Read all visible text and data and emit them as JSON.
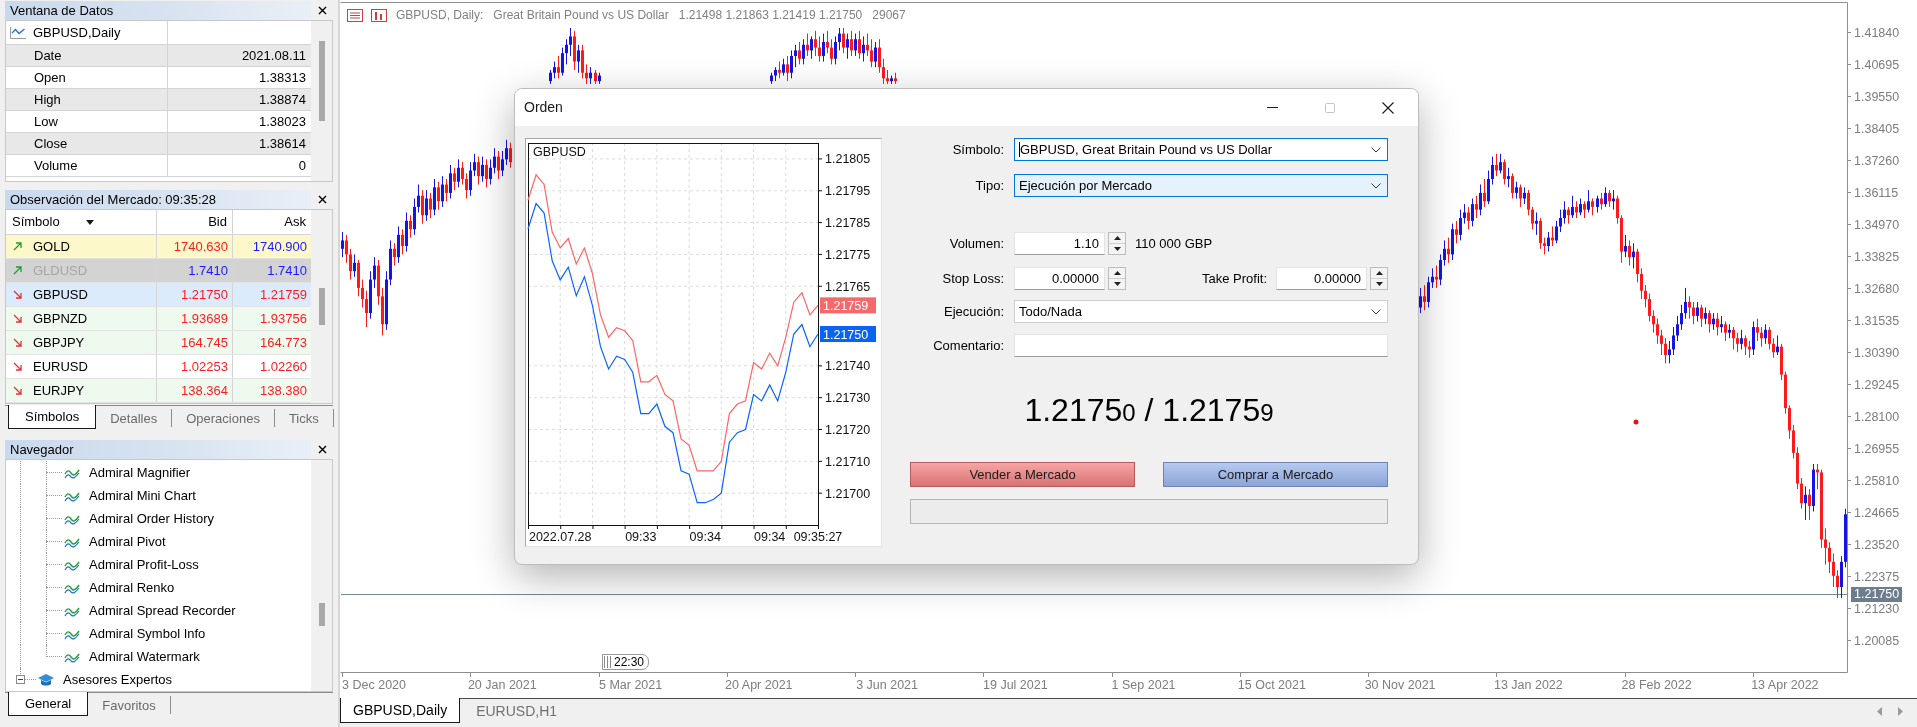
{
  "data_window": {
    "title": "Ventana de Datos",
    "header": "GBPUSD,Daily",
    "rows": [
      {
        "label": "Date",
        "value": "2021.08.11"
      },
      {
        "label": "Open",
        "value": "1.38313"
      },
      {
        "label": "High",
        "value": "1.38874"
      },
      {
        "label": "Low",
        "value": "1.38023"
      },
      {
        "label": "Close",
        "value": "1.38614"
      },
      {
        "label": "Volume",
        "value": "0"
      }
    ]
  },
  "market_watch": {
    "title": "Observación del Mercado: 09:35:28",
    "columns": [
      "Símbolo",
      "Bid",
      "Ask"
    ],
    "rows": [
      {
        "symbol": "GOLD",
        "rising": true,
        "bid": "1740.630",
        "bid_up": false,
        "ask": "1740.900",
        "ask_up": true,
        "selected": false,
        "disabled": false,
        "color": "#fdf8c9"
      },
      {
        "symbol": "GLDUSD",
        "rising": true,
        "bid": "1.7410",
        "bid_up": true,
        "ask": "1.7410",
        "ask_up": true,
        "selected": false,
        "disabled": true
      },
      {
        "symbol": "GBPUSD",
        "rising": false,
        "bid": "1.21750",
        "bid_up": false,
        "ask": "1.21759",
        "ask_up": false,
        "selected": true,
        "disabled": false
      },
      {
        "symbol": "GBPNZD",
        "rising": false,
        "bid": "1.93689",
        "bid_up": false,
        "ask": "1.93756",
        "ask_up": false,
        "selected": false,
        "disabled": false,
        "color": "#eefaee"
      },
      {
        "symbol": "GBPJPY",
        "rising": false,
        "bid": "164.745",
        "bid_up": false,
        "ask": "164.773",
        "ask_up": false,
        "selected": false,
        "disabled": false,
        "color": "#eefaee"
      },
      {
        "symbol": "EURUSD",
        "rising": false,
        "bid": "1.02253",
        "bid_up": false,
        "ask": "1.02260",
        "ask_up": false,
        "selected": false,
        "disabled": false,
        "color": "#ffffff"
      },
      {
        "symbol": "EURJPY",
        "rising": false,
        "bid": "138.364",
        "bid_up": false,
        "ask": "138.380",
        "ask_up": false,
        "selected": false,
        "disabled": false,
        "color": "#eefaee"
      }
    ],
    "tabs": [
      {
        "label": "Símbolos",
        "selected": true
      },
      {
        "label": "Detalles",
        "selected": false
      },
      {
        "label": "Operaciones",
        "selected": false
      },
      {
        "label": "Ticks",
        "selected": false
      }
    ]
  },
  "navigator": {
    "title": "Navegador",
    "items": [
      {
        "children": [
          {
            "label": "Admiral Magnifier"
          },
          {
            "label": "Admiral Mini Chart"
          },
          {
            "label": "Admiral Order History"
          },
          {
            "label": "Admiral Pivot"
          },
          {
            "label": "Admiral Profit-Loss"
          },
          {
            "label": "Admiral Renko"
          },
          {
            "label": "Admiral Spread Recorder"
          },
          {
            "label": "Admiral Symbol Info"
          },
          {
            "label": "Admiral Watermark"
          }
        ]
      },
      {
        "label": "Asesores Expertos",
        "expanded": true
      }
    ],
    "tabs": [
      {
        "label": "General",
        "selected": true
      },
      {
        "label": "Favoritos",
        "selected": false
      }
    ]
  },
  "chart": {
    "title": {
      "symbol": "GBPUSD, Daily:",
      "description": "Great Britain Pound vs US Dollar",
      "ohlc": "1.21498 1.21863 1.21419 1.21750",
      "volume": "29067"
    },
    "time_marker": "22:30",
    "chart_data": {
      "type": "candlestick",
      "ylim": [
        1.18958,
        1.42931
      ],
      "yticks": [
        {
          "value": 1.4184,
          "label": "1.41840"
        },
        {
          "value": 1.40695,
          "label": "1.40695"
        },
        {
          "value": 1.3955,
          "label": "1.39550"
        },
        {
          "value": 1.38405,
          "label": "1.38405"
        },
        {
          "value": 1.3726,
          "label": "1.37260"
        },
        {
          "value": 1.36115,
          "label": "1.36115"
        },
        {
          "value": 1.3497,
          "label": "1.34970"
        },
        {
          "value": 1.33825,
          "label": "1.33825"
        },
        {
          "value": 1.3268,
          "label": "1.32680"
        },
        {
          "value": 1.31535,
          "label": "1.31535"
        },
        {
          "value": 1.3039,
          "label": "1.30390"
        },
        {
          "value": 1.29245,
          "label": "1.29245"
        },
        {
          "value": 1.281,
          "label": "1.28100"
        },
        {
          "value": 1.26955,
          "label": "1.26955"
        },
        {
          "value": 1.2581,
          "label": "1.25810"
        },
        {
          "value": 1.24665,
          "label": "1.24665"
        },
        {
          "value": 1.2352,
          "label": "1.23520"
        },
        {
          "value": 1.22375,
          "label": "1.22375"
        },
        {
          "value": 1.2123,
          "label": "1.21230"
        },
        {
          "value": 1.20085,
          "label": "1.20085"
        }
      ],
      "ref_lines": [
        {
          "axis": "y",
          "value": 1.2175,
          "label": "1.21750"
        }
      ],
      "categories": [
        null,
        null,
        null,
        null,
        null,
        null,
        null,
        null,
        "3 Dec 2020",
        null,
        null,
        null,
        null,
        null,
        null,
        null,
        null,
        null,
        null,
        null,
        null,
        null,
        null,
        null,
        null,
        null,
        null,
        null,
        null,
        null,
        null,
        null,
        null,
        null,
        null,
        null,
        null,
        null,
        null,
        null,
        "20 Jan 2021",
        null,
        null,
        null,
        null,
        null,
        null,
        null,
        null,
        null,
        null,
        null,
        null,
        null,
        null,
        null,
        null,
        null,
        null,
        null,
        null,
        null,
        null,
        null,
        null,
        null,
        null,
        null,
        null,
        null,
        null,
        null,
        "5 Mar 2021",
        null,
        null,
        null,
        null,
        null,
        null,
        null,
        null,
        null,
        null,
        null,
        null,
        null,
        null,
        null,
        null,
        null,
        null,
        null,
        null,
        null,
        null,
        null,
        null,
        null,
        null,
        null,
        null,
        null,
        null,
        null,
        "20 Apr 2021",
        null,
        null,
        null,
        null,
        null,
        null,
        null,
        null,
        null,
        null,
        null,
        null,
        null,
        null,
        null,
        null,
        null,
        null,
        null,
        null,
        null,
        null,
        null,
        null,
        null,
        null,
        null,
        null,
        null,
        null,
        null,
        "3 Jun 2021",
        null,
        null,
        null,
        null,
        null,
        null,
        null,
        null,
        null,
        null,
        null,
        null,
        null,
        null,
        null,
        null,
        null,
        null,
        null,
        null,
        null,
        null,
        null,
        null,
        null,
        null,
        null,
        null,
        null,
        null,
        null,
        "19 Jul 2021",
        null,
        null,
        null,
        null,
        null,
        null,
        null,
        null,
        null,
        null,
        null,
        null,
        null,
        null,
        null,
        null,
        null,
        null,
        null,
        null,
        null,
        null,
        null,
        null,
        null,
        null,
        null,
        null,
        null,
        null,
        null,
        "1 Sep 2021",
        null,
        null,
        null,
        null,
        null,
        null,
        null,
        null,
        null,
        null,
        null,
        null,
        null,
        null,
        null,
        null,
        null,
        null,
        null,
        null,
        null,
        null,
        null,
        null,
        null,
        null,
        null,
        null,
        null,
        null,
        null,
        "15 Oct 2021",
        null,
        null,
        null,
        null,
        null,
        null,
        null,
        null,
        null,
        null,
        null,
        null,
        null,
        null,
        null,
        null,
        null,
        null,
        null,
        null,
        null,
        null,
        null,
        null,
        null,
        null,
        null,
        null,
        null,
        null,
        null,
        "30 Nov 2021",
        null,
        null,
        null,
        null,
        null,
        null,
        null,
        null,
        null,
        null,
        null,
        null,
        null,
        null,
        null,
        null,
        null,
        null,
        null,
        null,
        null,
        null,
        null,
        null,
        null,
        null,
        null,
        null,
        null,
        null,
        null,
        "13 Jan 2022",
        null,
        null,
        null,
        null,
        null,
        null,
        null,
        null,
        null,
        null,
        null,
        null,
        null,
        null,
        null,
        null,
        null,
        null,
        null,
        null,
        null,
        null,
        null,
        null,
        null,
        null,
        null,
        null,
        null,
        null,
        null,
        "28 Feb 2022",
        null,
        null,
        null,
        null,
        null,
        null,
        null,
        null,
        null,
        null,
        null,
        null,
        null,
        null,
        null,
        null,
        null,
        null,
        null,
        null,
        null,
        null,
        null,
        null,
        null,
        null,
        null,
        null,
        null,
        null,
        null,
        "13 Apr 2022",
        null,
        null,
        null,
        null,
        null,
        null,
        null,
        null,
        null,
        null,
        null,
        null,
        null,
        null,
        null
      ],
      "ohlc": [
        [
          1.341,
          1.347,
          1.338,
          1.344
        ],
        [
          1.344,
          1.346,
          1.336,
          1.339
        ],
        [
          1.339,
          1.341,
          1.33,
          1.333
        ],
        [
          1.333,
          1.339,
          1.331,
          1.336
        ],
        [
          1.336,
          1.337,
          1.324,
          1.327
        ],
        [
          1.327,
          1.33,
          1.32,
          1.323
        ],
        [
          1.323,
          1.326,
          1.313,
          1.318
        ],
        [
          1.318,
          1.333,
          1.316,
          1.33
        ],
        [
          1.33,
          1.338,
          1.327,
          1.335
        ],
        [
          1.335,
          1.337,
          1.321,
          1.324
        ],
        [
          1.324,
          1.327,
          1.31,
          1.314
        ],
        [
          1.314,
          1.333,
          1.312,
          1.33
        ],
        [
          1.33,
          1.344,
          1.328,
          1.341
        ],
        [
          1.341,
          1.343,
          1.335,
          1.338
        ],
        [
          1.338,
          1.349,
          1.336,
          1.346
        ],
        [
          1.346,
          1.348,
          1.339,
          1.342
        ],
        [
          1.342,
          1.354,
          1.34,
          1.351
        ],
        [
          1.351,
          1.353,
          1.345,
          1.348
        ],
        [
          1.348,
          1.359,
          1.346,
          1.356
        ],
        [
          1.356,
          1.364,
          1.354,
          1.36
        ],
        [
          1.36,
          1.362,
          1.35,
          1.353
        ],
        [
          1.353,
          1.362,
          1.351,
          1.359
        ],
        [
          1.359,
          1.361,
          1.352,
          1.355
        ],
        [
          1.355,
          1.366,
          1.353,
          1.363
        ],
        [
          1.363,
          1.365,
          1.355,
          1.358
        ],
        [
          1.358,
          1.367,
          1.356,
          1.364
        ],
        [
          1.364,
          1.366,
          1.358,
          1.361
        ],
        [
          1.361,
          1.371,
          1.359,
          1.368
        ],
        [
          1.368,
          1.37,
          1.362,
          1.365
        ],
        [
          1.365,
          1.373,
          1.363,
          1.37
        ],
        [
          1.37,
          1.372,
          1.364,
          1.366
        ],
        [
          1.366,
          1.368,
          1.359,
          1.362
        ],
        [
          1.362,
          1.372,
          1.36,
          1.369
        ],
        [
          1.369,
          1.375,
          1.367,
          1.372
        ],
        [
          1.372,
          1.374,
          1.364,
          1.367
        ],
        [
          1.367,
          1.374,
          1.365,
          1.371
        ],
        [
          1.371,
          1.373,
          1.363,
          1.366
        ],
        [
          1.366,
          1.373,
          1.364,
          1.37
        ],
        [
          1.37,
          1.377,
          1.368,
          1.374
        ],
        [
          1.374,
          1.376,
          1.366,
          1.369
        ],
        [
          1.369,
          1.376,
          1.367,
          1.373
        ],
        [
          1.373,
          1.38,
          1.371,
          1.377
        ],
        [
          1.377,
          1.379,
          1.37,
          1.372
        ],
        null,
        null,
        null,
        null,
        null,
        null,
        null,
        null,
        null,
        [
          1.401,
          1.405,
          1.4,
          1.404
        ],
        [
          1.404,
          1.408,
          1.402,
          1.406
        ],
        [
          1.406,
          1.41,
          1.402,
          1.404
        ],
        [
          1.404,
          1.413,
          1.403,
          1.411
        ],
        [
          1.411,
          1.416,
          1.407,
          1.414
        ],
        [
          1.414,
          1.42,
          1.41,
          1.417
        ],
        [
          1.417,
          1.419,
          1.405,
          1.408
        ],
        [
          1.408,
          1.414,
          1.404,
          1.412
        ],
        [
          1.412,
          1.414,
          1.402,
          1.404
        ],
        [
          1.404,
          1.407,
          1.4,
          1.402
        ],
        [
          1.402,
          1.406,
          1.4,
          1.404
        ],
        [
          1.404,
          1.405,
          1.4,
          1.401
        ],
        [
          1.401,
          1.404,
          1.4,
          1.403
        ],
        null,
        null,
        null,
        null,
        null,
        null,
        null,
        null,
        null,
        null,
        null,
        null,
        null,
        null,
        null,
        null,
        null,
        null,
        null,
        null,
        null,
        null,
        null,
        null,
        null,
        null,
        null,
        null,
        null,
        null,
        null,
        null,
        null,
        null,
        null,
        null,
        null,
        null,
        null,
        null,
        null,
        null,
        [
          1.401,
          1.404,
          1.4,
          1.403
        ],
        [
          1.403,
          1.406,
          1.401,
          1.405
        ],
        [
          1.405,
          1.408,
          1.402,
          1.404
        ],
        [
          1.404,
          1.409,
          1.403,
          1.407
        ],
        [
          1.407,
          1.41,
          1.401,
          1.404
        ],
        [
          1.404,
          1.412,
          1.402,
          1.41
        ],
        [
          1.41,
          1.414,
          1.406,
          1.412
        ],
        [
          1.412,
          1.415,
          1.407,
          1.409
        ],
        [
          1.409,
          1.416,
          1.407,
          1.414
        ],
        [
          1.414,
          1.418,
          1.41,
          1.412
        ],
        [
          1.412,
          1.417,
          1.409,
          1.416
        ],
        [
          1.416,
          1.419,
          1.41,
          1.413
        ],
        [
          1.413,
          1.417,
          1.408,
          1.41
        ],
        [
          1.41,
          1.418,
          1.408,
          1.415
        ],
        [
          1.415,
          1.419,
          1.411,
          1.413
        ],
        [
          1.413,
          1.416,
          1.407,
          1.409
        ],
        [
          1.409,
          1.417,
          1.407,
          1.415
        ],
        [
          1.415,
          1.42,
          1.412,
          1.418
        ],
        [
          1.418,
          1.42,
          1.411,
          1.413
        ],
        [
          1.413,
          1.418,
          1.409,
          1.416
        ],
        [
          1.416,
          1.419,
          1.41,
          1.412
        ],
        [
          1.412,
          1.418,
          1.41,
          1.416
        ],
        [
          1.416,
          1.419,
          1.409,
          1.411
        ],
        [
          1.411,
          1.417,
          1.408,
          1.414
        ],
        [
          1.414,
          1.418,
          1.41,
          1.412
        ],
        [
          1.412,
          1.416,
          1.406,
          1.408
        ],
        [
          1.408,
          1.415,
          1.406,
          1.413
        ],
        [
          1.413,
          1.416,
          1.404,
          1.406
        ],
        [
          1.406,
          1.409,
          1.4,
          1.402
        ],
        [
          1.402,
          1.405,
          1.4,
          1.401
        ],
        [
          1.401,
          1.403,
          1.4,
          1.402
        ],
        [
          1.402,
          1.404,
          1.4,
          1.401
        ],
        null,
        null,
        null,
        null,
        null,
        null,
        null,
        null,
        null,
        null,
        null,
        null,
        null,
        null,
        null,
        null,
        null,
        null,
        null,
        null,
        null,
        null,
        null,
        null,
        null,
        null,
        null,
        null,
        null,
        null,
        null,
        null,
        null,
        null,
        null,
        null,
        null,
        null,
        null,
        null,
        null,
        null,
        null,
        null,
        null,
        null,
        null,
        null,
        null,
        null,
        null,
        null,
        null,
        null,
        null,
        null,
        null,
        null,
        null,
        null,
        null,
        null,
        null,
        null,
        null,
        null,
        null,
        null,
        null,
        null,
        null,
        null,
        null,
        null,
        null,
        null,
        null,
        null,
        null,
        null,
        null,
        null,
        null,
        null,
        null,
        null,
        null,
        null,
        null,
        null,
        null,
        null,
        null,
        null,
        null,
        null,
        null,
        null,
        null,
        null,
        null,
        null,
        null,
        null,
        null,
        null,
        null,
        null,
        null,
        null,
        null,
        null,
        null,
        null,
        null,
        null,
        null,
        null,
        null,
        null,
        null,
        null,
        null,
        null,
        null,
        null,
        null,
        null,
        null,
        null,
        [
          1.32,
          1.327,
          1.318,
          1.324
        ],
        [
          1.324,
          1.328,
          1.319,
          1.322
        ],
        [
          1.322,
          1.331,
          1.32,
          1.329
        ],
        [
          1.329,
          1.334,
          1.327,
          1.331
        ],
        [
          1.331,
          1.335,
          1.327,
          1.33
        ],
        [
          1.33,
          1.339,
          1.328,
          1.337
        ],
        [
          1.337,
          1.344,
          1.335,
          1.341
        ],
        [
          1.341,
          1.345,
          1.336,
          1.339
        ],
        [
          1.339,
          1.35,
          1.337,
          1.348
        ],
        [
          1.348,
          1.351,
          1.343,
          1.346
        ],
        [
          1.346,
          1.355,
          1.344,
          1.352
        ],
        [
          1.352,
          1.357,
          1.35,
          1.354
        ],
        [
          1.354,
          1.356,
          1.348,
          1.351
        ],
        [
          1.351,
          1.359,
          1.349,
          1.357
        ],
        [
          1.357,
          1.36,
          1.352,
          1.355
        ],
        [
          1.355,
          1.364,
          1.353,
          1.361
        ],
        [
          1.361,
          1.366,
          1.356,
          1.358
        ],
        [
          1.358,
          1.369,
          1.357,
          1.366
        ],
        [
          1.366,
          1.374,
          1.364,
          1.371
        ],
        [
          1.371,
          1.375,
          1.367,
          1.369
        ],
        [
          1.369,
          1.375,
          1.368,
          1.372
        ],
        [
          1.372,
          1.373,
          1.364,
          1.366
        ],
        [
          1.366,
          1.37,
          1.363,
          1.367
        ],
        [
          1.367,
          1.368,
          1.359,
          1.361
        ],
        [
          1.361,
          1.365,
          1.359,
          1.363
        ],
        [
          1.363,
          1.364,
          1.356,
          1.359
        ],
        [
          1.359,
          1.363,
          1.357,
          1.361
        ],
        [
          1.361,
          1.362,
          1.353,
          1.355
        ],
        [
          1.355,
          1.356,
          1.348,
          1.35
        ],
        [
          1.35,
          1.354,
          1.346,
          1.351
        ],
        [
          1.351,
          1.352,
          1.341,
          1.343
        ],
        [
          1.343,
          1.345,
          1.339,
          1.342
        ],
        [
          1.342,
          1.347,
          1.34,
          1.345
        ],
        [
          1.345,
          1.349,
          1.342,
          1.344
        ],
        [
          1.344,
          1.351,
          1.343,
          1.349
        ],
        [
          1.349,
          1.355,
          1.347,
          1.352
        ],
        [
          1.352,
          1.358,
          1.35,
          1.355
        ],
        [
          1.355,
          1.356,
          1.35,
          1.353
        ],
        [
          1.353,
          1.36,
          1.352,
          1.356
        ],
        [
          1.356,
          1.358,
          1.352,
          1.354
        ],
        [
          1.354,
          1.359,
          1.353,
          1.357
        ],
        [
          1.357,
          1.358,
          1.352,
          1.355
        ],
        [
          1.355,
          1.362,
          1.354,
          1.358
        ],
        [
          1.358,
          1.359,
          1.353,
          1.356
        ],
        [
          1.356,
          1.36,
          1.354,
          1.359
        ],
        [
          1.359,
          1.361,
          1.355,
          1.357
        ],
        [
          1.357,
          1.363,
          1.356,
          1.361
        ],
        [
          1.361,
          1.362,
          1.356,
          1.358
        ],
        [
          1.358,
          1.362,
          1.355,
          1.359
        ],
        [
          1.359,
          1.36,
          1.35,
          1.352
        ],
        [
          1.352,
          1.353,
          1.336,
          1.34
        ],
        [
          1.34,
          1.346,
          1.338,
          1.342
        ],
        [
          1.342,
          1.344,
          1.335,
          1.338
        ],
        [
          1.338,
          1.343,
          1.334,
          1.34
        ],
        [
          1.34,
          1.341,
          1.329,
          1.332
        ],
        [
          1.332,
          1.334,
          1.323,
          1.326
        ],
        [
          1.326,
          1.328,
          1.32,
          1.323
        ],
        [
          1.323,
          1.325,
          1.315,
          1.317
        ],
        [
          1.317,
          1.319,
          1.311,
          1.314
        ],
        [
          1.314,
          1.316,
          1.307,
          1.31
        ],
        [
          1.31,
          1.312,
          1.303,
          1.307
        ],
        [
          1.307,
          1.309,
          1.3,
          1.303
        ],
        [
          1.303,
          1.308,
          1.3,
          1.305
        ],
        [
          1.305,
          1.313,
          1.303,
          1.31
        ],
        [
          1.31,
          1.317,
          1.308,
          1.314
        ],
        [
          1.314,
          1.321,
          1.312,
          1.318
        ],
        [
          1.318,
          1.327,
          1.316,
          1.322
        ],
        [
          1.322,
          1.324,
          1.316,
          1.32
        ],
        [
          1.32,
          1.322,
          1.314,
          1.317
        ],
        [
          1.317,
          1.322,
          1.315,
          1.32
        ],
        [
          1.32,
          1.321,
          1.313,
          1.316
        ],
        [
          1.316,
          1.32,
          1.314,
          1.318
        ],
        [
          1.318,
          1.319,
          1.311,
          1.314
        ],
        [
          1.314,
          1.318,
          1.312,
          1.316
        ],
        [
          1.316,
          1.318,
          1.31,
          1.313
        ],
        [
          1.313,
          1.317,
          1.311,
          1.314
        ],
        [
          1.314,
          1.315,
          1.308,
          1.311
        ],
        [
          1.311,
          1.314,
          1.309,
          1.312
        ],
        [
          1.312,
          1.313,
          1.305,
          1.309
        ],
        [
          1.309,
          1.311,
          1.304,
          1.307
        ],
        [
          1.307,
          1.312,
          1.305,
          1.309
        ],
        [
          1.309,
          1.31,
          1.303,
          1.306
        ],
        [
          1.306,
          1.308,
          1.302,
          1.305
        ],
        [
          1.305,
          1.315,
          1.303,
          1.313
        ],
        [
          1.313,
          1.316,
          1.308,
          1.311
        ],
        [
          1.311,
          1.313,
          1.306,
          1.309
        ],
        [
          1.309,
          1.314,
          1.307,
          1.312
        ],
        [
          1.312,
          1.313,
          1.305,
          1.307
        ],
        [
          1.307,
          1.309,
          1.302,
          1.304
        ],
        [
          1.304,
          1.31,
          1.303,
          1.306
        ],
        [
          1.306,
          1.307,
          1.294,
          1.296
        ],
        [
          1.296,
          1.297,
          1.282,
          1.284
        ],
        [
          1.284,
          1.285,
          1.273,
          1.276
        ],
        [
          1.276,
          1.278,
          1.266,
          1.268
        ],
        [
          1.268,
          1.27,
          1.255,
          1.257
        ],
        [
          1.257,
          1.259,
          1.248,
          1.25
        ],
        [
          1.25,
          1.256,
          1.244,
          1.253
        ],
        [
          1.253,
          1.255,
          1.244,
          1.249
        ],
        [
          1.249,
          1.264,
          1.247,
          1.262
        ],
        [
          1.262,
          1.264,
          1.255,
          1.261
        ],
        [
          1.261,
          1.262,
          1.234,
          1.237
        ],
        [
          1.237,
          1.241,
          1.228,
          1.234
        ],
        [
          1.234,
          1.236,
          1.225,
          1.229
        ],
        [
          1.229,
          1.232,
          1.22,
          1.224
        ],
        [
          1.224,
          1.226,
          1.216,
          1.22
        ],
        [
          1.22,
          1.231,
          1.216,
          1.229
        ],
        [
          1.229,
          1.248,
          1.227,
          1.246
        ]
      ]
    }
  },
  "chart_tabs": [
    {
      "label": "GBPUSD,Daily",
      "selected": true
    },
    {
      "label": "EURUSD,H1",
      "selected": false
    }
  ],
  "order_dialog": {
    "title": "Orden",
    "controls": [
      {
        "kind": "minimize",
        "disabled": false
      },
      {
        "kind": "maximize",
        "disabled": true
      },
      {
        "kind": "close",
        "disabled": false
      }
    ],
    "tick_chart": {
      "chart_data": {
        "type": "line",
        "title": "GBPUSD",
        "grid": true,
        "categories": [
          null,
          null,
          null,
          null,
          "2022.07.28",
          null,
          null,
          null,
          null,
          null,
          null,
          null,
          null,
          null,
          "09:33",
          null,
          null,
          null,
          null,
          null,
          null,
          null,
          "09:34",
          null,
          null,
          null,
          null,
          null,
          null,
          null,
          "09:34",
          null,
          null,
          null,
          null,
          null,
          "09:35:27"
        ],
        "ylim": [
          1.2169,
          1.2181
        ],
        "yticks": [
          {
            "value": 1.21805,
            "label": "1.21805"
          },
          {
            "value": 1.21795,
            "label": "1.21795"
          },
          {
            "value": 1.21785,
            "label": "1.21785"
          },
          {
            "value": 1.21775,
            "label": "1.21775"
          },
          {
            "value": 1.21765,
            "label": "1.21765"
          },
          {
            "value": 1.2174,
            "label": "1.21740"
          },
          {
            "value": 1.2173,
            "label": "1.21730"
          },
          {
            "value": 1.2172,
            "label": "1.21720"
          },
          {
            "value": 1.2171,
            "label": "1.21710"
          },
          {
            "value": 1.217,
            "label": "1.21700"
          }
        ],
        "series": [
          {
            "color": "#ff6464",
            "values": [
              1.21792,
              1.218,
              1.21797,
              1.21782,
              1.21777,
              1.2178,
              1.21772,
              1.21777,
              1.21769,
              1.21756,
              1.21749,
              1.21752,
              1.21751,
              1.21748,
              1.21735,
              1.21735,
              1.21737,
              1.21731,
              1.21729,
              1.21717,
              1.21715,
              1.21707,
              1.21707,
              1.21707,
              1.2171,
              1.21725,
              1.21728,
              1.21729,
              1.21741,
              1.21739,
              1.21744,
              1.2174,
              1.21749,
              1.2176,
              1.21763,
              1.21756,
              1.21759
            ]
          },
          {
            "color": "#0a64ff",
            "values": [
              1.21783,
              1.21791,
              1.21788,
              1.21773,
              1.21767,
              1.21771,
              1.21762,
              1.21768,
              1.21759,
              1.21746,
              1.21739,
              1.21743,
              1.21742,
              1.21738,
              1.21725,
              1.21725,
              1.21728,
              1.21721,
              1.21719,
              1.21707,
              1.21706,
              1.21697,
              1.21697,
              1.21698,
              1.217,
              1.21716,
              1.21719,
              1.2172,
              1.21731,
              1.21729,
              1.21734,
              1.21729,
              1.21738,
              1.2175,
              1.21753,
              1.21746,
              1.2175
            ]
          }
        ]
      },
      "price_tags": [
        {
          "label": "1.21759",
          "color": "#f46a6a"
        },
        {
          "label": "1.21750",
          "color": "#0a64f0"
        }
      ]
    },
    "fields": [
      {
        "kind": "combo",
        "label": "Símbolo:",
        "value": "GBPUSD, Great Britain Pound vs US Dollar",
        "focused": true,
        "hovered": false
      },
      {
        "kind": "combo",
        "label": "Tipo:",
        "value": "Ejecución por Mercado",
        "focused": false,
        "hovered": true
      },
      {
        "kind": "spin",
        "label": "Volumen:",
        "value": "1.10",
        "note": "110 000 GBP"
      },
      {
        "kind": "spin_pair",
        "label": "Stop Loss:",
        "value": "0.00000",
        "label_2": "Take Profit:",
        "value_2": "0.00000"
      },
      {
        "kind": "combo",
        "label": "Ejecución:",
        "value": "Todo/Nada",
        "focused": false,
        "hovered": false
      },
      {
        "kind": "text",
        "label": "Comentario:"
      }
    ],
    "quote": {
      "bid": "1.2175",
      "bid_last": "0",
      "separator": "/",
      "ask": "1.2175",
      "ask_last": "9"
    },
    "buttons": [
      {
        "kind": "sell",
        "label": "Vender a Mercado"
      },
      {
        "kind": "buy",
        "label": "Comprar a Mercado"
      }
    ]
  }
}
